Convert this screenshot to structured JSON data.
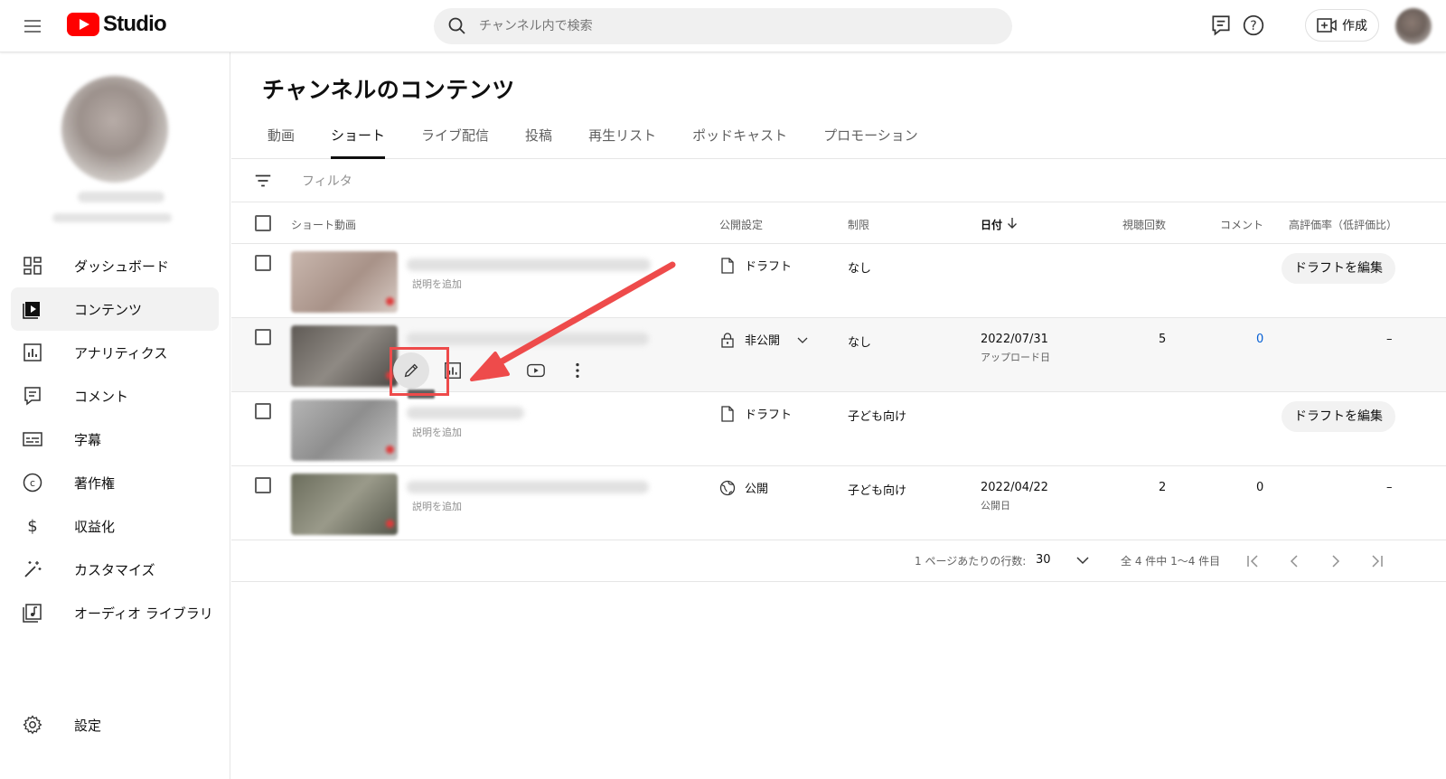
{
  "header": {
    "logo_text": "Studio",
    "search_placeholder": "チャンネル内で検索",
    "create_label": "作成",
    "icons": [
      "menu-icon",
      "youtube-logo-icon",
      "search-icon",
      "feedback-icon",
      "help-icon",
      "create-video-icon"
    ]
  },
  "sidebar": {
    "items": [
      {
        "label": "ダッシュボード",
        "icon": "dashboard-icon"
      },
      {
        "label": "コンテンツ",
        "icon": "content-icon",
        "active": true
      },
      {
        "label": "アナリティクス",
        "icon": "analytics-icon"
      },
      {
        "label": "コメント",
        "icon": "comment-icon"
      },
      {
        "label": "字幕",
        "icon": "subtitles-icon"
      },
      {
        "label": "著作権",
        "icon": "copyright-icon"
      },
      {
        "label": "収益化",
        "icon": "dollar-icon"
      },
      {
        "label": "カスタマイズ",
        "icon": "magic-wand-icon"
      },
      {
        "label": "オーディオ ライブラリ",
        "icon": "audio-library-icon"
      }
    ],
    "settings_label": "設定"
  },
  "main": {
    "title": "チャンネルのコンテンツ",
    "tabs": [
      "動画",
      "ショート",
      "ライブ配信",
      "投稿",
      "再生リスト",
      "ポッドキャスト",
      "プロモーション"
    ],
    "active_tab": "ショート",
    "filter_placeholder": "フィルタ",
    "columns": {
      "video": "ショート動画",
      "visibility": "公開設定",
      "restriction": "制限",
      "date": "日付",
      "views": "視聴回数",
      "comments": "コメント",
      "ratio": "高評価率（低評価比）"
    },
    "rows": [
      {
        "desc": "説明を追加",
        "visibility": "ドラフト",
        "visibility_icon": "draft-icon",
        "restriction": "なし",
        "date": "",
        "date_sub": "",
        "views": "",
        "comments": "",
        "ratio": "",
        "action": "ドラフトを編集"
      },
      {
        "desc": "",
        "visibility": "非公開",
        "visibility_icon": "lock-icon",
        "restriction": "なし",
        "date": "2022/07/31",
        "date_sub": "アップロード日",
        "views": "5",
        "comments": "0",
        "ratio": "–",
        "action": ""
      },
      {
        "desc": "説明を追加",
        "visibility": "ドラフト",
        "visibility_icon": "draft-icon",
        "restriction": "子ども向け",
        "date": "",
        "date_sub": "",
        "views": "",
        "comments": "",
        "ratio": "",
        "action": "ドラフトを編集"
      },
      {
        "desc": "説明を追加",
        "visibility": "公開",
        "visibility_icon": "globe-icon",
        "restriction": "子ども向け",
        "date": "2022/04/22",
        "date_sub": "公開日",
        "views": "2",
        "comments": "0",
        "ratio": "–",
        "action": ""
      }
    ],
    "row_actions": [
      "pencil-icon",
      "analytics-icon",
      "comment-icon",
      "youtube-play-icon",
      "more-vert-icon"
    ],
    "pagination": {
      "rows_per_page_label": "1 ページあたりの行数:",
      "rows_per_page": "30",
      "range": "全 4 件中 1〜4 件目"
    }
  },
  "colors": {
    "youtube_red": "#ff0000",
    "annotation_red": "#ee4b4b",
    "link_blue": "#065fd4"
  }
}
